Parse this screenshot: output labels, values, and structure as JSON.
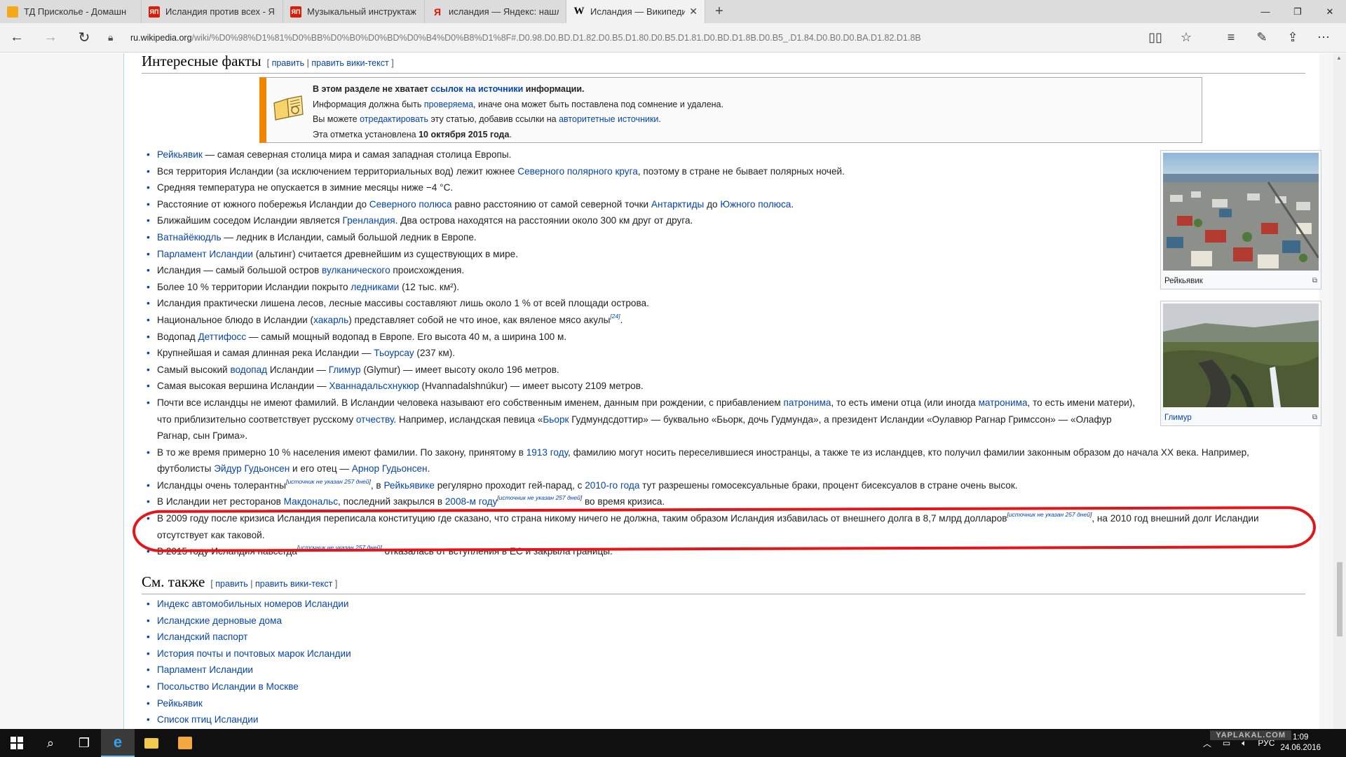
{
  "tabs": [
    {
      "title": "ТД Присколье - Домашн",
      "favicon": "orange-square-icon"
    },
    {
      "title": "Исландия против всех - ЯГ",
      "favicon": "yaplakal-icon"
    },
    {
      "title": "Музыкальный инструктаж б",
      "favicon": "yaplakal-icon"
    },
    {
      "title": "исландия — Яндекс: нашл",
      "favicon": "yandex-icon"
    },
    {
      "title": "Исландия — Википеди",
      "favicon": "wikipedia-icon"
    }
  ],
  "address": {
    "domain": "ru.wikipedia.org",
    "path": "/wiki/%D0%98%D1%81%D0%BB%D0%B0%D0%BD%D0%B4%D0%B8%D1%8F#.D0.98.D0.BD.D1.82.D0.B5.D1.80.D0.B5.D1.81.D0.BD.D1.8B.D0.B5_.D1.84.D0.B0.D0.BA.D1.82.D1.8B"
  },
  "section1": {
    "title": "Интересные факты",
    "edit": "править",
    "edit_source": "править вики-текст",
    "sep": "|"
  },
  "ambox": {
    "l1_a": "В этом разделе не хватает ",
    "l1_link": "ссылок на источники",
    "l1_b": " информации.",
    "l2_a": "Информация должна быть ",
    "l2_link": "проверяема",
    "l2_b": ", иначе она может быть поставлена под сомнение и удалена.",
    "l3_a": "Вы можете ",
    "l3_link1": "отредактировать",
    "l3_b": " эту статью, добавив ссылки на ",
    "l3_link2": "авторитетные источники",
    "l3_c": ".",
    "l4_a": "Эта отметка установлена ",
    "l4_b": "10 октября 2015 года",
    "l4_c": "."
  },
  "cn": "источник не указан 257 дней",
  "facts": {
    "f1_link": "Рейкьявик",
    "f1": " — самая северная столица мира и самая западная столица Европы.",
    "f2_a": "Вся территория Исландии (за исключением территориальных вод) лежит южнее ",
    "f2_link": "Северного полярного круга",
    "f2_b": ", поэтому в стране не бывает полярных ночей.",
    "f3": "Средняя температура не опускается в зимние месяцы ниже −4 °C.",
    "f4_a": "Расстояние от южного побережья Исландии до ",
    "f4_l1": "Северного полюса",
    "f4_b": " равно расстоянию от самой северной точки ",
    "f4_l2": "Антарктиды",
    "f4_c": " до ",
    "f4_l3": "Южного полюса",
    "f4_d": ".",
    "f5_a": "Ближайшим соседом Исландии является ",
    "f5_link": "Гренландия",
    "f5_b": ". Два острова находятся на расстоянии около 300 км друг от друга.",
    "f6_link": "Ватнайёкюдль",
    "f6": " — ледник в Исландии, самый большой ледник в Европе.",
    "f7_link": "Парламент Исландии",
    "f7": " (альтинг) считается древнейшим из существующих в мире.",
    "f8_a": "Исландия — самый большой остров ",
    "f8_link": "вулканического",
    "f8_b": " происхождения.",
    "f9_a": "Более 10 % территории Исландии покрыто ",
    "f9_link": "ледниками",
    "f9_b": " (12 тыс. км²).",
    "f10": "Исландия практически лишена лесов, лесные массивы составляют лишь около 1 % от всей площади острова.",
    "f11_a": "Национальное блюдо в Исландии (",
    "f11_link": "хакарль",
    "f11_b": ") представляет собой не что иное, как вяленое мясо акулы",
    "f11_ref": "[24]",
    "f11_c": ".",
    "f12_a": "Водопад ",
    "f12_link": "Деттифосс",
    "f12_b": " — самый мощный водопад в Европе. Его высота 40 м, а ширина 100 м.",
    "f13_a": "Крупнейшая и самая длинная река Исландии — ",
    "f13_link": "Тьоурсау",
    "f13_b": " (237 км).",
    "f14_a": "Самый высокий ",
    "f14_l1": "водопад",
    "f14_b": " Исландии — ",
    "f14_l2": "Глимур",
    "f14_c": " (Glymur) — имеет высоту около 196 метров.",
    "f15_a": "Самая высокая вершина Исландии — ",
    "f15_link": "Хваннадальсхнукюр",
    "f15_b": " (Hvannadalshnúkur) — имеет высоту 2109 метров.",
    "f16_a": "Почти все исландцы не имеют фамилий. В Исландии человека называют его собственным именем, данным при рождении, с прибавлением ",
    "f16_l1": "патронима",
    "f16_b": ", то есть имени отца (или иногда ",
    "f16_l2": "матронима",
    "f16_c": ", то есть имени матери), что приблизительно соответствует русскому ",
    "f16_l3": "отчеству",
    "f16_d": ". Например, исландская певица «",
    "f16_l4": "Бьорк",
    "f16_e": " Гудмундсдоттир» — буквально «Бьорк, дочь Гудмунда», а президент Исландии «Оулавюр Рагнар Гримссон» — «Олафур Рагнар, сын Грима».",
    "f17_a": "В то же время примерно 10 % населения имеют фамилии. По закону, принятому в ",
    "f17_l1": "1913 году",
    "f17_b": ", фамилию могут носить переселившиеся иностранцы, а также те из исландцев, кто получил фамилии законным образом до начала XX века. Например, футболисты ",
    "f17_l2": "Эйдур Гудьонсен",
    "f17_c": " и его отец — ",
    "f17_l3": "Арнор Гудьонсен",
    "f17_d": ".",
    "f18_a": "Исландцы очень толерантны",
    "f18_b": ", в ",
    "f18_l1": "Рейкьявике",
    "f18_c": " регулярно проходит гей-парад, с ",
    "f18_l2": "2010-го года",
    "f18_d": " тут разрешены гомосексуальные браки, процент бисексуалов в стране очень высок.",
    "f19_a": "В Исландии нет ресторанов ",
    "f19_l1": "Макдональс",
    "f19_b": ", последний закрылся в ",
    "f19_l2": "2008-м году",
    "f19_c": " во время кризиса.",
    "f20_a": "В 2009 году после кризиса Исландия переписала конституцию где сказано, что страна никому ничего не должна, таким образом Исландия избавилась от внешнего долга в 8,7 млрд долларов",
    "f20_b": ", на 2010 год внешний долг Исландии отсутствует как таковой.",
    "f21_a": "В 2015 году Исландия навсегда",
    "f21_b": " отказалась от вступления в ЕС и закрыла границы."
  },
  "thumbs": [
    {
      "caption": "Рейкьявик"
    },
    {
      "caption": "Глимур"
    }
  ],
  "section2": {
    "title": "См. также",
    "edit": "править",
    "edit_source": "править вики-текст",
    "sep": "|"
  },
  "see_also": [
    "Индекс автомобильных номеров Исландии",
    "Исландские дерновые дома",
    "Исландский паспорт",
    "История почты и почтовых марок Исландии",
    "Парламент Исландии",
    "Посольство Исландии в Москве",
    "Рейкьявик",
    "Список птиц Исландии"
  ],
  "taskbar": {
    "lang": "РУС",
    "time": "1:09",
    "date": "24.06.2016",
    "watermark": "YAPLAKAL.COM"
  },
  "colors": {
    "link": "#0645ad",
    "ambox_accent": "#f28500",
    "highlight": "#e3161a"
  }
}
